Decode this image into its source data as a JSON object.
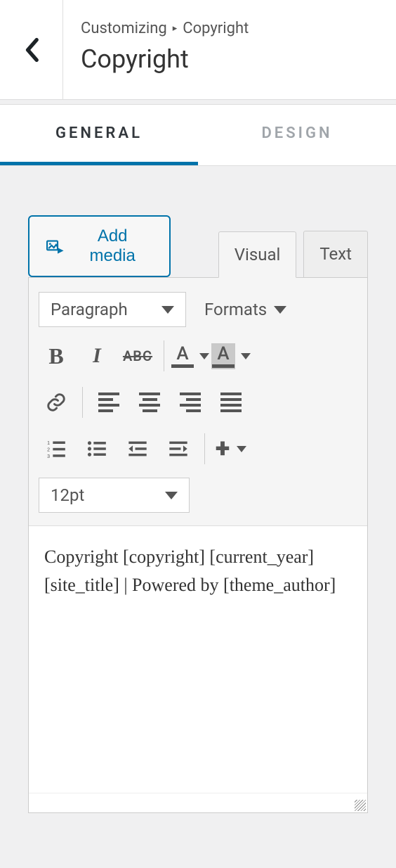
{
  "header": {
    "breadcrumb_root": "Customizing",
    "breadcrumb_current": "Copyright",
    "title": "Copyright"
  },
  "tabs": {
    "general": "GENERAL",
    "design": "DESIGN"
  },
  "editor": {
    "add_media_label": "Add media",
    "tab_visual": "Visual",
    "tab_text": "Text",
    "paragraph_label": "Paragraph",
    "formats_label": "Formats",
    "strike_label": "ABC",
    "font_size_label": "12pt",
    "content": "Copyright [copyright] [current_year] [site_title] | Powered by [theme_author]"
  },
  "colors": {
    "accent": "#0073aa",
    "text": "#555",
    "border": "#ccc"
  }
}
